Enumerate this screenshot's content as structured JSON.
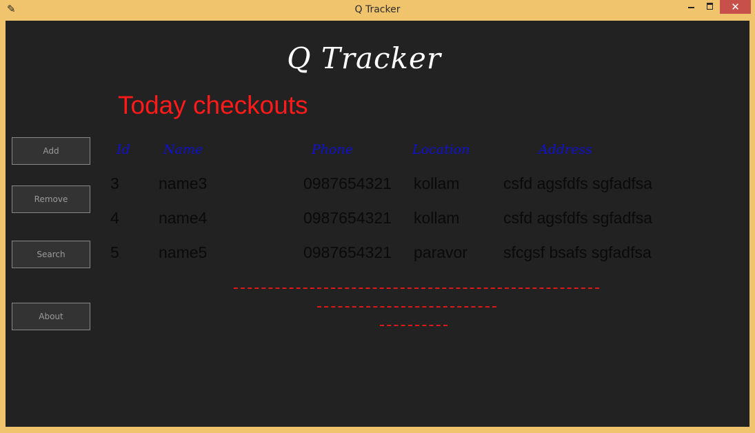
{
  "window": {
    "title": "Q Tracker",
    "app_icon": "feather-icon",
    "controls": {
      "minimize": "minimize-icon",
      "maximize": "maximize-icon",
      "close": "✕"
    }
  },
  "header": {
    "app_name": "Q Tracker"
  },
  "section": {
    "title": "Today checkouts"
  },
  "sidebar": {
    "buttons": [
      {
        "label": "Add"
      },
      {
        "label": "Remove"
      },
      {
        "label": "Search"
      },
      {
        "label": "About"
      }
    ]
  },
  "table": {
    "columns": [
      "Id",
      "Name",
      "Phone",
      "Location",
      "Address"
    ],
    "rows": [
      [
        "3",
        "name3",
        "0987654321",
        "kollam",
        "csfd agsfdfs sgfadfsa"
      ],
      [
        "4",
        "name4",
        "0987654321",
        "kollam",
        "csfd agsfdfs sgfadfsa"
      ],
      [
        "5",
        "name5",
        "0987654321",
        "paravor",
        "sfcgsf bsafs sgfadfsa"
      ]
    ]
  },
  "colors": {
    "background": "#222222",
    "frame": "#f0c46c",
    "section_title": "#ff1a1a",
    "column_header": "#1010d0",
    "close_button": "#c7504a",
    "dashes": "#e01818"
  }
}
